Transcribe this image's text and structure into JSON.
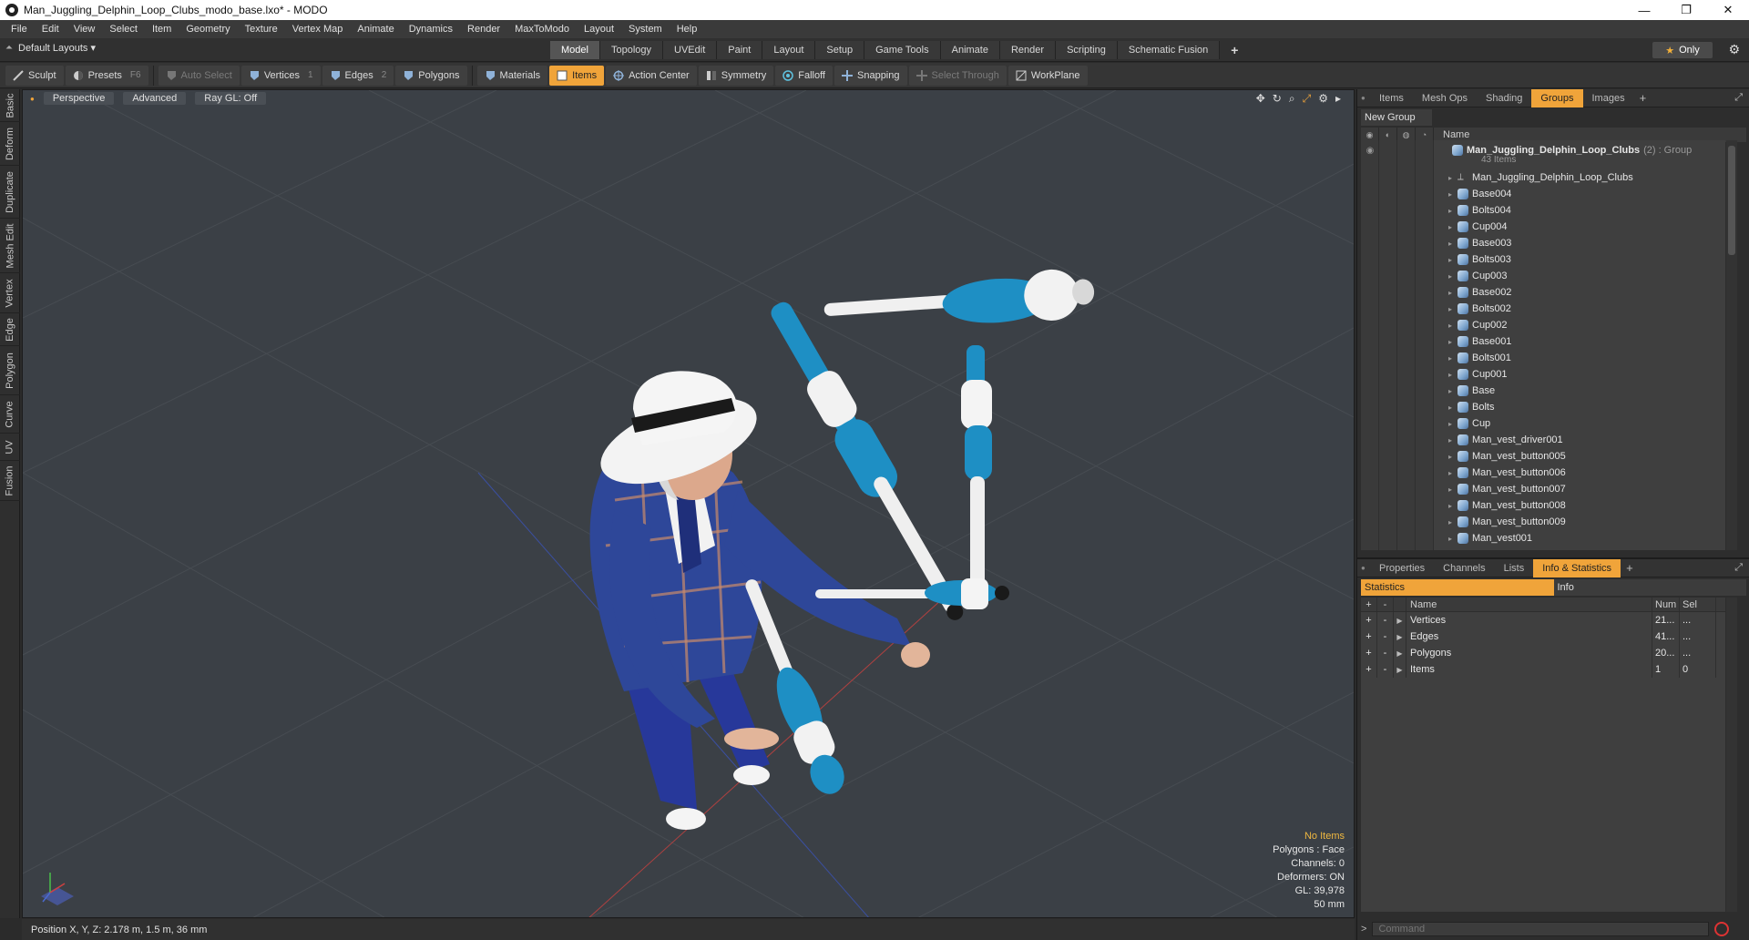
{
  "window": {
    "title": "Man_Juggling_Delphin_Loop_Clubs_modo_base.lxo* - MODO",
    "controls": [
      "—",
      "❐",
      "✕"
    ]
  },
  "menu": [
    "File",
    "Edit",
    "View",
    "Select",
    "Item",
    "Geometry",
    "Texture",
    "Vertex Map",
    "Animate",
    "Dynamics",
    "Render",
    "MaxToModo",
    "Layout",
    "System",
    "Help"
  ],
  "layoutbar": {
    "layout_name": "Default Layouts ▾",
    "tabs": [
      "Model",
      "Topology",
      "UVEdit",
      "Paint",
      "Layout",
      "Setup",
      "Game Tools",
      "Animate",
      "Render",
      "Scripting",
      "Schematic Fusion"
    ],
    "active_tab": "Model",
    "only_label": "Only"
  },
  "toolbar": {
    "sculpt": "Sculpt",
    "presets": "Presets",
    "presets_key": "F6",
    "auto_select": "Auto Select",
    "vertices": "Vertices",
    "vertices_key": "1",
    "edges": "Edges",
    "edges_key": "2",
    "polygons": "Polygons",
    "materials": "Materials",
    "items": "Items",
    "action_center": "Action Center",
    "symmetry": "Symmetry",
    "falloff": "Falloff",
    "snapping": "Snapping",
    "select_through": "Select Through",
    "workplane": "WorkPlane"
  },
  "left_tabs": [
    "Basic",
    "Deform",
    "Duplicate",
    "Mesh Edit",
    "Vertex",
    "Edge",
    "Polygon",
    "Curve",
    "UV",
    "Fusion"
  ],
  "viewport": {
    "perspective": "Perspective",
    "advanced": "Advanced",
    "raygl": "Ray GL: Off",
    "hud": {
      "no_items": "No Items",
      "polygons": "Polygons : Face",
      "channels": "Channels: 0",
      "deformers": "Deformers: ON",
      "gl": "GL: 39,978",
      "scale": "50 mm"
    },
    "colors": {
      "club_blue": "#1e8fc4",
      "club_white": "#f2f2f2",
      "suit_blue": "#2b3f8f",
      "background": "#3b4046"
    }
  },
  "status": {
    "position": "Position X, Y, Z:  2.178 m, 1.5 m, 36 mm"
  },
  "groups_panel": {
    "tabs": [
      "Items",
      "Mesh Ops",
      "Shading",
      "Groups",
      "Images"
    ],
    "active_tab": "Groups",
    "new_group": "New Group",
    "col_name": "Name",
    "group_name": "Man_Juggling_Delphin_Loop_Clubs",
    "group_count": "(2) : Group",
    "group_items": "43 Items",
    "items": [
      "Man_Juggling_Delphin_Loop_Clubs",
      "Base004",
      "Bolts004",
      "Cup004",
      "Base003",
      "Bolts003",
      "Cup003",
      "Base002",
      "Bolts002",
      "Cup002",
      "Base001",
      "Bolts001",
      "Cup001",
      "Base",
      "Bolts",
      "Cup",
      "Man_vest_driver001",
      "Man_vest_button005",
      "Man_vest_button006",
      "Man_vest_button007",
      "Man_vest_button008",
      "Man_vest_button009",
      "Man_vest001"
    ]
  },
  "stats_panel": {
    "tabs": [
      "Properties",
      "Channels",
      "Lists",
      "Info & Statistics"
    ],
    "active_tab": "Info & Statistics",
    "subtabs": [
      "Statistics",
      "Info"
    ],
    "columns": {
      "name": "Name",
      "num": "Num",
      "sel": "Sel"
    },
    "rows": [
      {
        "name": "Vertices",
        "num": "21...",
        "sel": "..."
      },
      {
        "name": "Edges",
        "num": "41...",
        "sel": "..."
      },
      {
        "name": "Polygons",
        "num": "20...",
        "sel": "..."
      },
      {
        "name": "Items",
        "num": "1",
        "sel": "0"
      }
    ]
  },
  "command": {
    "placeholder": "Command"
  }
}
